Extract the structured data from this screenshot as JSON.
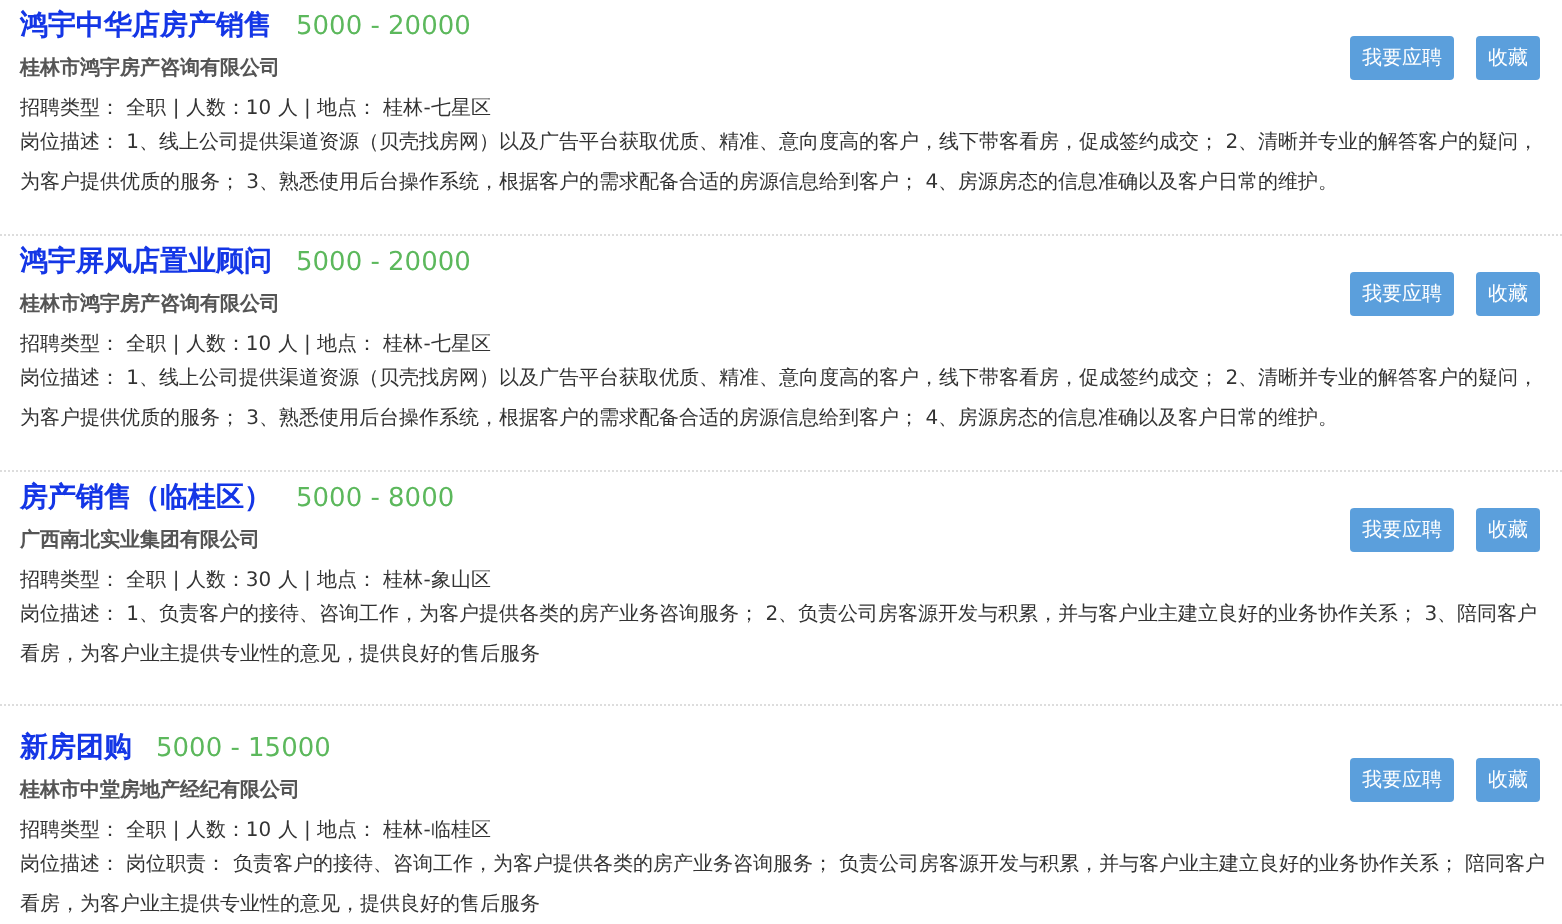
{
  "jobs": [
    {
      "title": "鸿宇中华店房产销售",
      "salary": "5000 - 20000",
      "company": "桂林市鸿宇房产咨询有限公司",
      "meta": "招聘类型： 全职 | 人数：10 人 | 地点： 桂林-七星区",
      "description": "岗位描述： 1、线上公司提供渠道资源（贝壳找房网）以及广告平台获取优质、精准、意向度高的客户，线下带客看房，促成签约成交； 2、清晰并专业的解答客户的疑问，为客户提供优质的服务； 3、熟悉使用后台操作系统，根据客户的需求配备合适的房源信息给到客户； 4、房源房态的信息准确以及客户日常的维护。",
      "buttons": [
        "我要应聘",
        "收藏"
      ]
    },
    {
      "title": "鸿宇屏风店置业顾问",
      "salary": "5000 - 20000",
      "company": "桂林市鸿宇房产咨询有限公司",
      "meta": "招聘类型： 全职 | 人数：10 人 | 地点： 桂林-七星区",
      "description": "岗位描述： 1、线上公司提供渠道资源（贝壳找房网）以及广告平台获取优质、精准、意向度高的客户，线下带客看房，促成签约成交； 2、清晰并专业的解答客户的疑问，为客户提供优质的服务； 3、熟悉使用后台操作系统，根据客户的需求配备合适的房源信息给到客户； 4、房源房态的信息准确以及客户日常的维护。",
      "buttons": [
        "我要应聘",
        "收藏"
      ]
    },
    {
      "title": "房产销售（临桂区）",
      "salary": "5000 - 8000",
      "company": "广西南北实业集团有限公司",
      "meta": "招聘类型： 全职 | 人数：30 人 | 地点： 桂林-象山区",
      "description": "岗位描述： 1、负责客户的接待、咨询工作，为客户提供各类的房产业务咨询服务； 2、负责公司房客源开发与积累，并与客户业主建立良好的业务协作关系； 3、陪同客户看房，为客户业主提供专业性的意见，提供良好的售后服务",
      "buttons": [
        "我要应聘",
        "收藏"
      ]
    },
    {
      "title": "新房团购",
      "salary": "5000 - 15000",
      "company": "桂林市中堂房地产经纪有限公司",
      "meta": "招聘类型： 全职 | 人数：10 人 | 地点： 桂林-临桂区",
      "description": "岗位描述： 岗位职责： 负责客户的接待、咨询工作，为客户提供各类的房产业务咨询服务； 负责公司房客源开发与积累，并与客户业主建立良好的业务协作关系； 陪同客户看房，为客户业主提供专业性的意见，提供良好的售后服务",
      "buttons": [
        "我要应聘",
        "收藏"
      ]
    }
  ]
}
